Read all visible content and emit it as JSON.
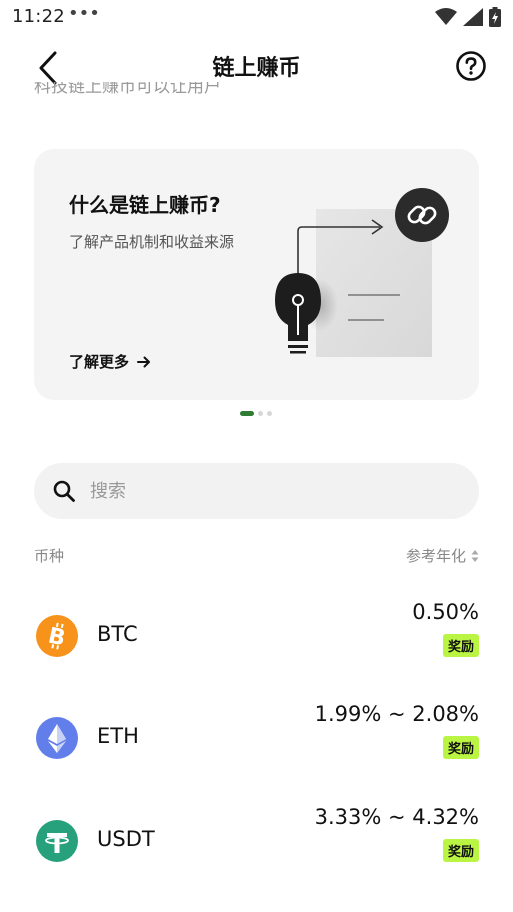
{
  "status_bar": {
    "time": "11:22",
    "more": "•••",
    "icons": [
      "wifi-icon",
      "signal-icon",
      "battery-icon"
    ]
  },
  "nav": {
    "title": "链上赚币",
    "back_icon": "chevron-left-icon",
    "help_icon": "help-circle-icon"
  },
  "cut_off_text": "科技链上赚币可以让用户",
  "banner": {
    "title": "什么是链上赚币?",
    "subtitle": "了解产品机制和收益来源",
    "link_label": "了解更多",
    "link_icon": "arrow-right-icon",
    "background": "#f4f4f4",
    "illustration_icons": [
      "link-icon",
      "lightbulb-icon",
      "document-icon"
    ]
  },
  "pager": {
    "count": 3,
    "active": 0,
    "active_color": "#2e7d32"
  },
  "search": {
    "placeholder": "搜索",
    "value": "",
    "icon": "search-icon"
  },
  "list": {
    "header_coin": "币种",
    "header_apy": "参考年化",
    "sort_icon": "sort-icon",
    "rows": [
      {
        "name": "BTC",
        "apy": "0.50%",
        "badge": "奖励",
        "logo_color": "#f7931a",
        "logo_icon": "bitcoin-logo"
      },
      {
        "name": "ETH",
        "apy": "1.99% ~ 2.08%",
        "badge": "奖励",
        "logo_color": "#627eea",
        "logo_icon": "ethereum-logo"
      },
      {
        "name": "USDT",
        "apy": "3.33% ~ 4.32%",
        "badge": "奖励",
        "logo_color": "#26a17b",
        "logo_icon": "tether-logo"
      }
    ],
    "badge_color": "#b9f542"
  }
}
